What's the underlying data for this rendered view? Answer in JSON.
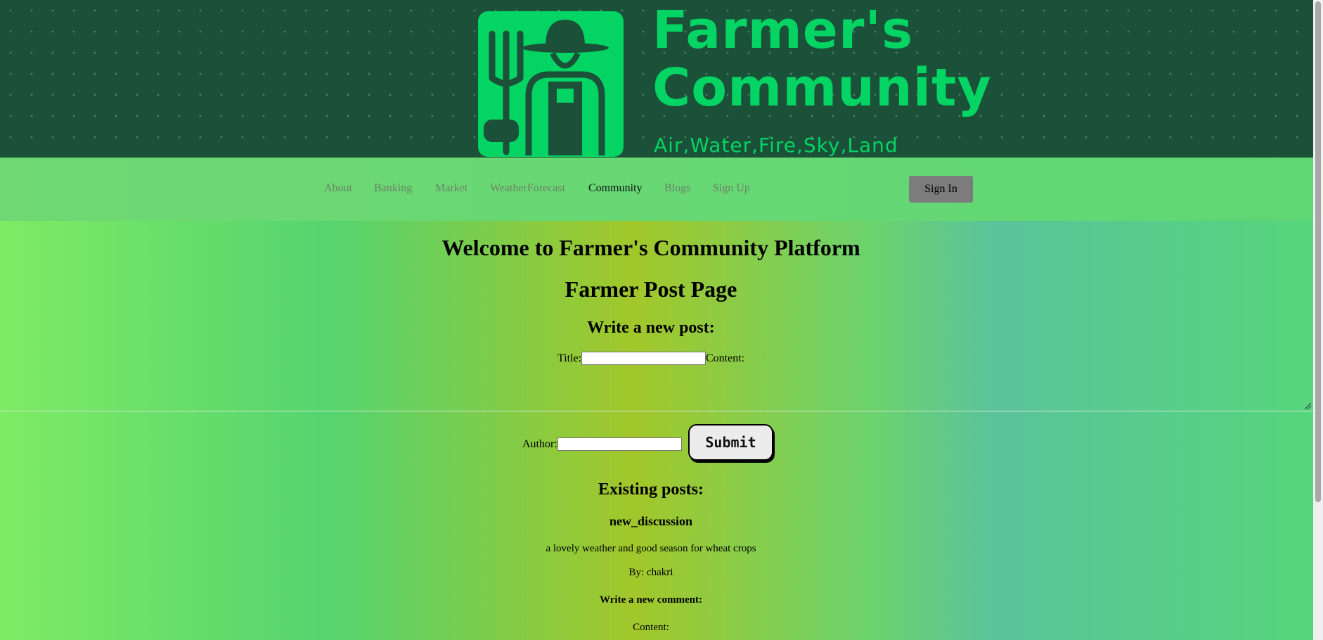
{
  "banner": {
    "logo_title_line1": "Farmer's",
    "logo_title_line2": "Community",
    "logo_tagline": "Air,Water,Fire,Sky,Land"
  },
  "nav": {
    "items": [
      {
        "label": "About"
      },
      {
        "label": "Banking"
      },
      {
        "label": "Market"
      },
      {
        "label": "WeatherForecast"
      },
      {
        "label": "Community"
      },
      {
        "label": "Blogs"
      },
      {
        "label": "Sign Up"
      }
    ],
    "active": "Community",
    "signin_label": "Sign In"
  },
  "main": {
    "welcome": "Welcome to Farmer's Community Platform",
    "page_title": "Farmer Post Page",
    "new_post_heading": "Write a new post:",
    "title_label": "Title:",
    "title_value": "",
    "content_label": "Content:",
    "author_label": "Author:",
    "author_value": "",
    "submit_label": "Submit"
  },
  "posts": {
    "heading": "Existing posts:",
    "items": [
      {
        "title": "new_discussion",
        "content": "a lovely weather and good season for wheat crops",
        "byline": "By: chakri",
        "comment_heading": "Write a new comment:",
        "comment_content_label": "Content:"
      }
    ]
  },
  "colors": {
    "banner_bg": "#1b5138",
    "logo_green": "#03d463",
    "navbar_bg": "#6fd873",
    "signin_bg": "#7c7c7c"
  }
}
